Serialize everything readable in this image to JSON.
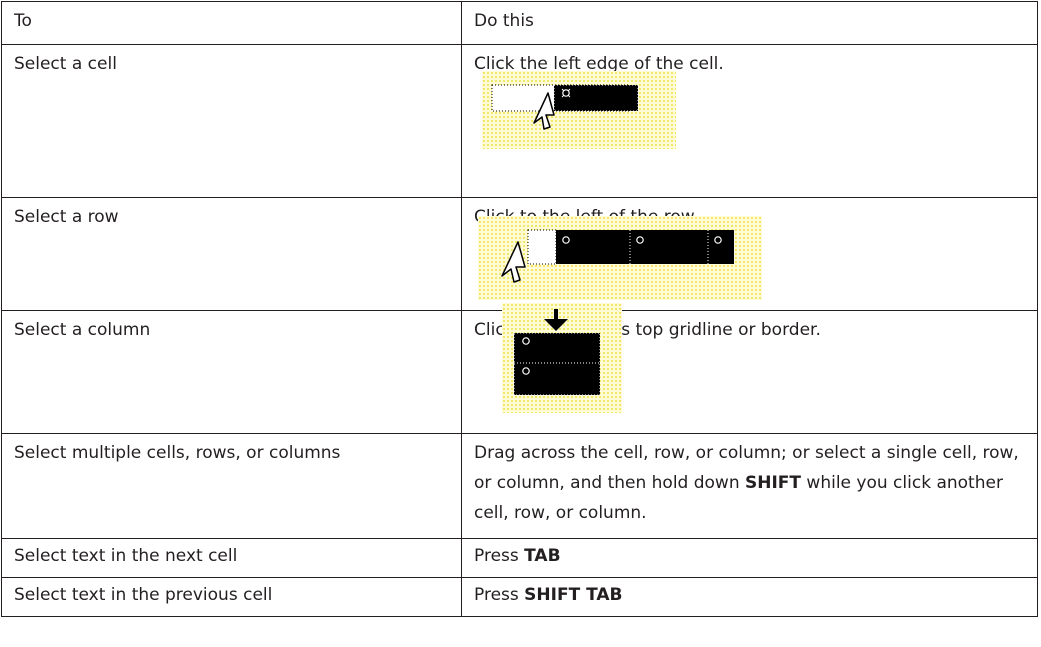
{
  "headers": {
    "to": "To",
    "do_this": "Do this"
  },
  "rows": [
    {
      "to": "Select a cell",
      "do_this": "Click the left edge of the cell."
    },
    {
      "to": "Select a row",
      "do_this": "Click to the left of the row."
    },
    {
      "to": "Select a column",
      "do_this": "Click the column’s top gridline or border."
    },
    {
      "to": "Select multiple cells, rows, or columns",
      "do_this_parts": [
        "Drag across the cell, row, or column; or select a single cell, row, or column, and then hold down ",
        "SHIFT",
        " while you click another cell, row, or column."
      ]
    },
    {
      "to": "Select text in the next cell",
      "do_this_prefix": "Press ",
      "key": "TAB"
    },
    {
      "to": "Select text in the previous cell",
      "do_this_prefix": "Press ",
      "key": "SHIFT TAB"
    }
  ],
  "icons": [
    "end-of-cell-marker-icon",
    "mouse-pointer-icon",
    "down-arrow-pointer-icon"
  ],
  "colors": {
    "text": "#231f20",
    "border": "#231f20",
    "highlight": "#fffbd6",
    "highlight_dots": "#ece34a",
    "selection": "#000000"
  }
}
